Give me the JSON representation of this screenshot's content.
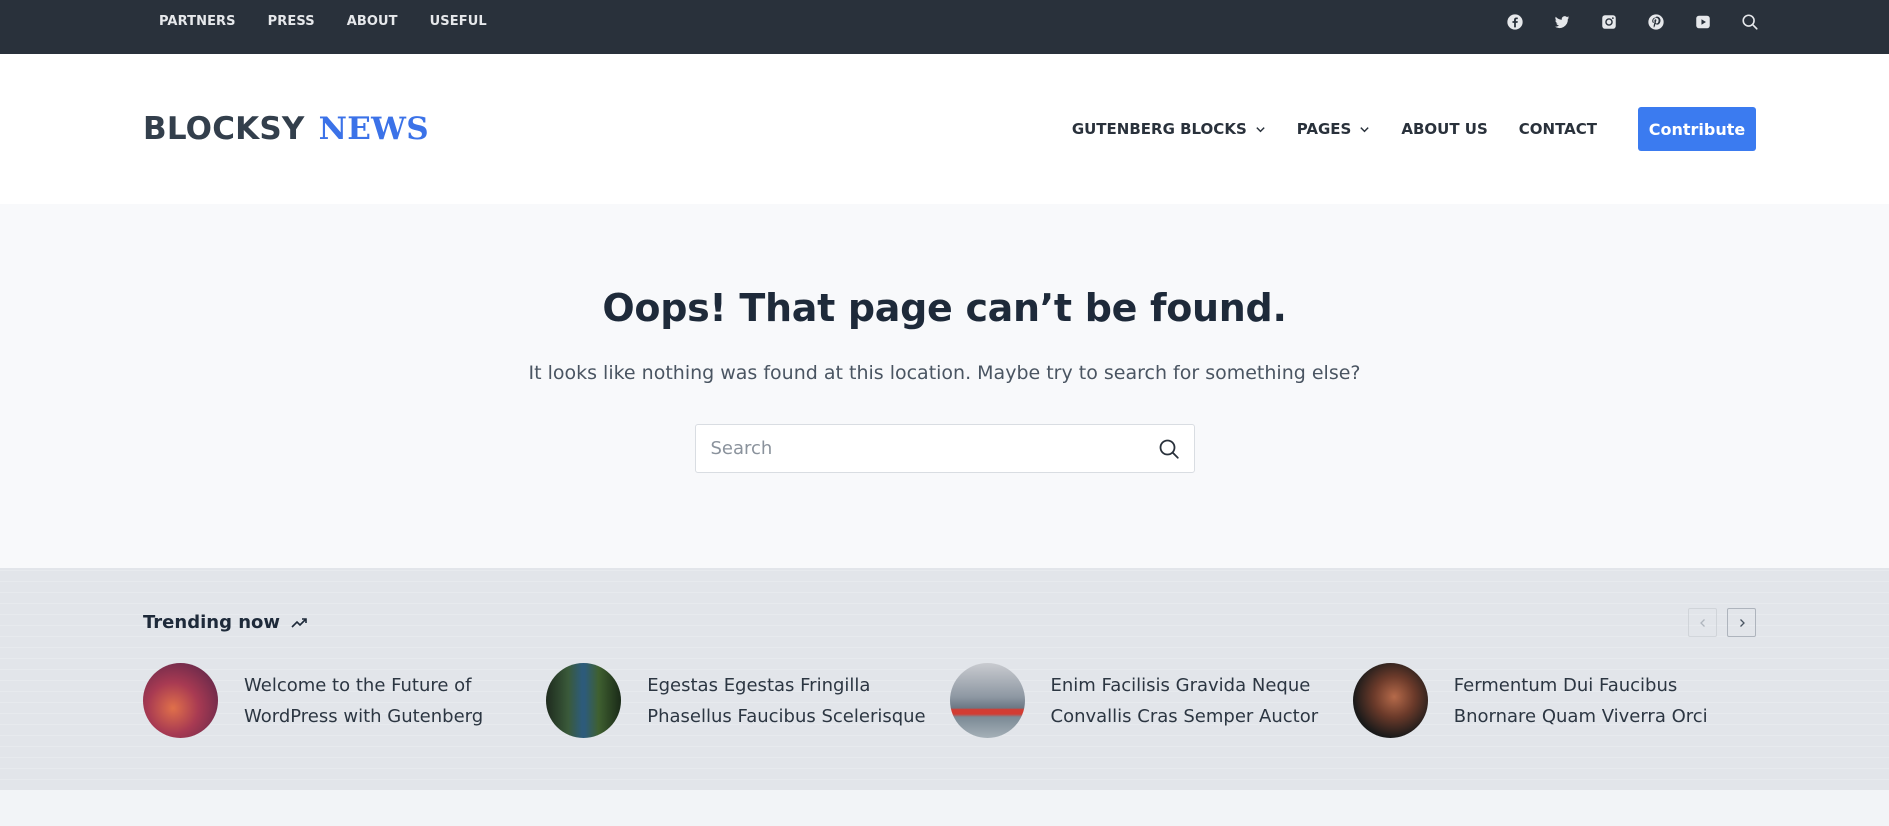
{
  "topbar": {
    "nav": [
      "PARTNERS",
      "PRESS",
      "ABOUT",
      "USEFUL"
    ],
    "social_icons": [
      "facebook-icon",
      "twitter-icon",
      "instagram-icon",
      "pinterest-icon",
      "youtube-icon",
      "search-icon"
    ]
  },
  "header": {
    "logo_part1": "BLOCKSY",
    "logo_part2": "NEWS",
    "nav": [
      {
        "label": "GUTENBERG BLOCKS",
        "has_dropdown": true
      },
      {
        "label": "PAGES",
        "has_dropdown": true
      },
      {
        "label": "ABOUT US",
        "has_dropdown": false
      },
      {
        "label": "CONTACT",
        "has_dropdown": false
      }
    ],
    "cta_label": "Contribute"
  },
  "hero": {
    "title": "Oops! That page can’t be found.",
    "message": "It looks like nothing was found at this location. Maybe try to search for something else?",
    "search_placeholder": "Search"
  },
  "trending": {
    "title": "Trending now",
    "items": [
      {
        "line1": "Welcome to the Future of",
        "line2": "WordPress with Gutenberg"
      },
      {
        "line1": "Egestas Egestas Fringilla",
        "line2": "Phasellus Faucibus Scelerisque"
      },
      {
        "line1": "Enim Facilisis Gravida Neque",
        "line2": "Convallis Cras Semper Auctor"
      },
      {
        "line1": "Fermentum Dui Faucibus",
        "line2": "Bnornare Quam Viverra Orci"
      }
    ]
  },
  "colors": {
    "topbar_bg": "#29313b",
    "accent": "#3b7bf0",
    "logo_news": "#3b72e8"
  }
}
